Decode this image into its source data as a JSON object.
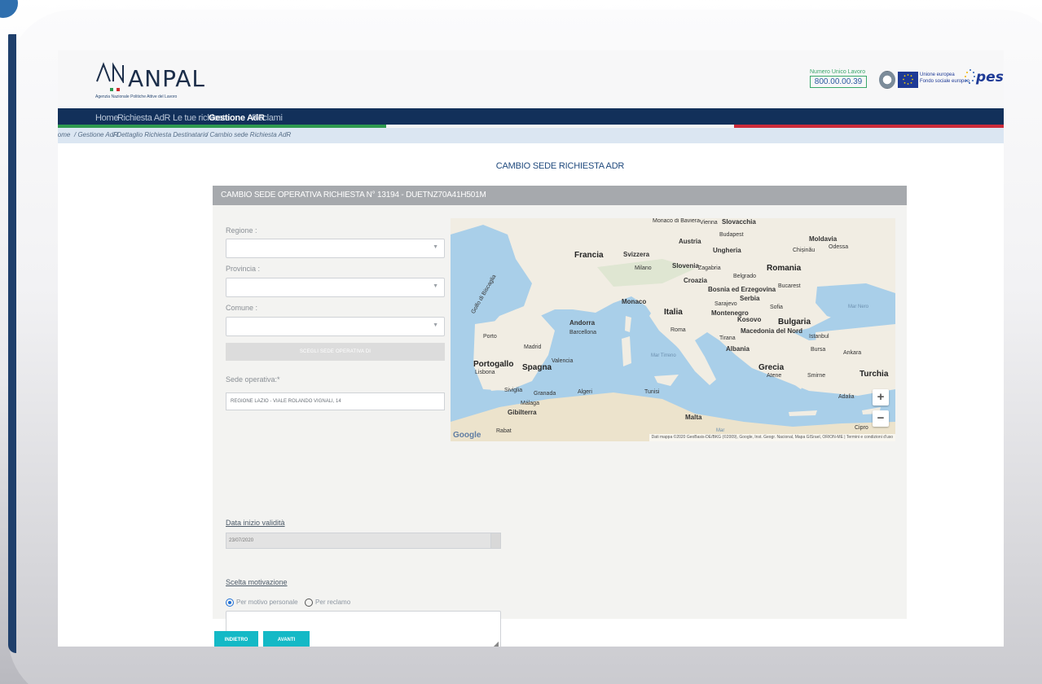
{
  "app": {
    "logo_text": "ANPAL",
    "logo_subtitle": "Agenzia Nazionale Politiche Attive del Lavoro"
  },
  "header": {
    "numero_label": "Numero Unico Lavoro",
    "numero_value": "800.00.00.39",
    "eu_text_line1": "Unione europea",
    "eu_text_line2": "Fondo sociale europeo",
    "pes_text": "pes"
  },
  "nav": {
    "items": [
      {
        "label": "Home",
        "active": false
      },
      {
        "label": "Richiesta AdR",
        "active": false
      },
      {
        "label": "Le tue richieste",
        "active": false
      },
      {
        "label": "Gestione AdR",
        "active": true
      },
      {
        "label": "Reclami",
        "active": false
      }
    ]
  },
  "breadcrumb": [
    "Home",
    "/ Gestione AdR",
    "/ Dettaglio Richiesta Destinatario",
    "/ Cambio sede Richiesta AdR"
  ],
  "page": {
    "title": "CAMBIO SEDE RICHIESTA ADR"
  },
  "panel": {
    "heading": "CAMBIO SEDE OPERATIVA RICHIESTA N° 13194 - DUETNZ70A41H501M",
    "regione_label": "Regione :",
    "regione_value": "",
    "provincia_label": "Provincia :",
    "provincia_value": "",
    "comune_label": "Comune :",
    "comune_value": "",
    "scegli_button": "SCEGLI SEDE OPERATIVA DI",
    "sede_label": "Sede operativa:*",
    "sede_value": "REGIONE LAZIO - VIALE ROLANDO VIGNALI, 14",
    "data_label": "Data inizio validità",
    "data_value": "23/07/2020",
    "motivazione_label": "Scelta motivazione",
    "radio_options": [
      {
        "label": "Per motivo personale",
        "selected": true
      },
      {
        "label": "Per reclamo",
        "selected": false
      }
    ],
    "motivazione_text": ""
  },
  "map": {
    "labels": {
      "francia": "Francia",
      "italia": "Italia",
      "spagna": "Spagna",
      "portogallo": "Portogallo",
      "romania": "Romania",
      "bulgaria": "Bulgaria",
      "grecia": "Grecia",
      "turchia": "Turchia",
      "svizzera": "Svizzera",
      "austria": "Austria",
      "ungheria": "Ungheria",
      "slovacchia": "Slovacchia",
      "moldavia": "Moldavia",
      "croazia": "Croazia",
      "serbia": "Serbia",
      "bosnia": "Bosnia ed Erzegovina",
      "montenegro": "Montenegro",
      "kosovo": "Kosovo",
      "albania": "Albania",
      "macedonia": "Macedonia del Nord",
      "slovenia": "Slovenia",
      "andorra": "Andorra",
      "monaco": "Monaco",
      "malta": "Malta",
      "gibilterra": "Gibilterra",
      "madrid": "Madrid",
      "barcellona": "Barcellona",
      "valencia": "Valencia",
      "siviglia": "Siviglia",
      "granada": "Granada",
      "malaga": "Málaga",
      "lisbona": "Lisbona",
      "porto": "Porto",
      "milano": "Milano",
      "roma": "Roma",
      "vienna": "Vienna",
      "budapest": "Budapest",
      "zagabria": "Zagabria",
      "belgrado": "Belgrado",
      "sarajevo": "Sarajevo",
      "sofia": "Sofia",
      "tirana": "Tirana",
      "bucarest": "Bucarest",
      "chisinau": "Chișinău",
      "odessa": "Odessa",
      "istanbul": "Istanbul",
      "bursa": "Bursa",
      "ankara": "Ankara",
      "atene": "Atene",
      "smirne": "Smirne",
      "adalia": "Adalia",
      "algeri": "Algeri",
      "tunisi": "Tunisi",
      "rabat": "Rabat",
      "cipro": "Cipro",
      "monaco_baviera": "Monaco di Baviera",
      "golfo": "Golfo di Biscaglia",
      "mar_tirreno": "Mar Tirreno",
      "mar_nero": "Mar Nero",
      "mar": "Mar"
    },
    "zoom_in": "+",
    "zoom_out": "−",
    "google": "Google",
    "attribution": "Dati mappa ©2020 GeoBasis-DE/BKG (©2009), Google, Inst. Geogr. Nacional, Mapa GISrael, ORION-ME | Termini e condizioni d'uso"
  },
  "buttons": {
    "indietro": "INDIETRO",
    "avanti": "AVANTI"
  },
  "colors": {
    "nav_bg": "#12305a",
    "accent_teal": "#14b9c6",
    "panel_head": "#a6a9ad",
    "title_blue": "#1f497d"
  }
}
